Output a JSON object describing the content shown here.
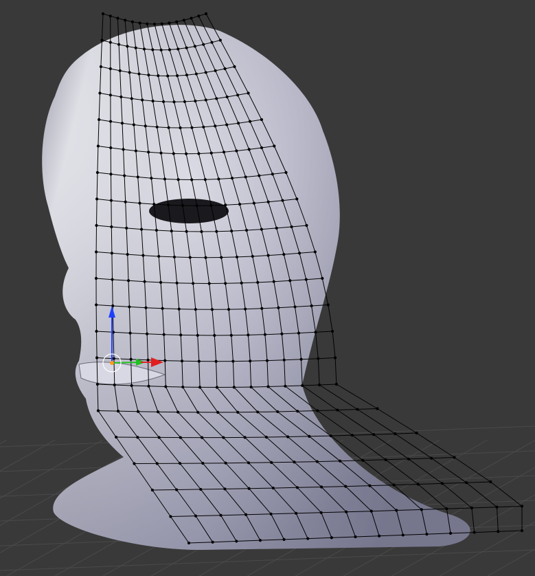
{
  "viewport": {
    "background": "#393939",
    "grid_color": "#4a4a4a",
    "mesh_light": "#f4f4fa",
    "mesh_mid": "#b9b9cc",
    "mesh_dark": "#6e6e80",
    "wire_color": "#000000"
  },
  "gizmo": {
    "x_axis_color": "#e02020",
    "y_axis_color": "#20c020",
    "z_axis_color": "#2040ff",
    "cursor_color": "#ffffff"
  }
}
